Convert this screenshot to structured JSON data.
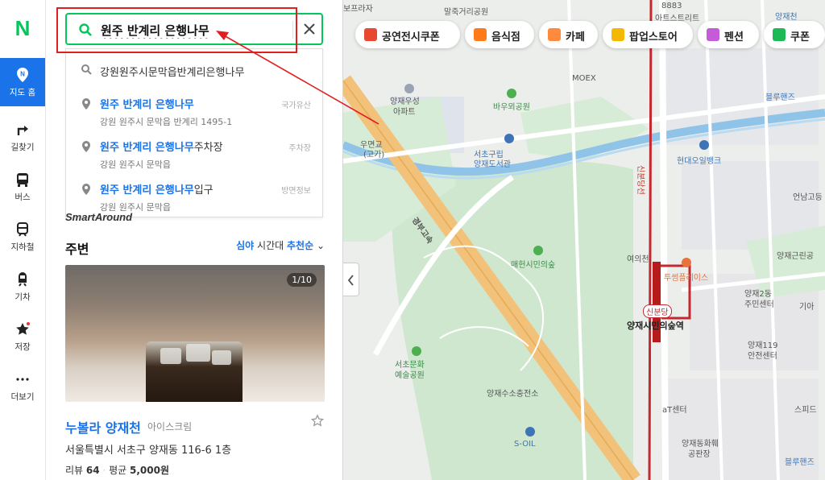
{
  "rail": {
    "logo": "N",
    "items": [
      {
        "label": "지도 홈",
        "icon": "map-pin-icon"
      },
      {
        "label": "길찾기",
        "icon": "directions-icon"
      },
      {
        "label": "버스",
        "icon": "bus-icon"
      },
      {
        "label": "지하철",
        "icon": "subway-icon"
      },
      {
        "label": "기차",
        "icon": "train-icon"
      },
      {
        "label": "저장",
        "icon": "star-icon"
      },
      {
        "label": "더보기",
        "icon": "more-icon"
      }
    ]
  },
  "search": {
    "value": "원주 반계리 은행나무",
    "suggestions": [
      {
        "title": "강원원주시문막읍반계리은행나무",
        "highlight": "",
        "rest": "",
        "sub": "",
        "category": ""
      },
      {
        "highlight": "원주 반계리 은행나무",
        "rest": "",
        "sub": "강원 원주시 문막읍 반계리 1495-1",
        "category": "국가유산"
      },
      {
        "highlight": "원주 반계리 은행나무",
        "rest": "주차장",
        "sub": "강원 원주시 문막읍",
        "category": "주차장"
      },
      {
        "highlight": "원주 반계리 은행나무",
        "rest": "입구",
        "sub": "강원 원주시 문막읍",
        "category": "방면정보"
      }
    ]
  },
  "panel": {
    "smart_around": "SmartAround",
    "nearby_title": "주변",
    "time_highlight": "심야",
    "time_label": " 시간대 ",
    "sort_label": "추천순",
    "photo_counter": "1/10",
    "place": {
      "name": "누볼라 양재천",
      "category": "아이스크림",
      "address": "서울특별시 서초구 양재동 116-6 1층",
      "reviews_label": "리뷰",
      "reviews_count": "64",
      "avg_label": "평균",
      "avg_price": "5,000원"
    }
  },
  "map": {
    "chips": [
      {
        "label": "공연전시쿠폰",
        "color": "#e8482f"
      },
      {
        "label": "음식점",
        "color": "#ff7a1a"
      },
      {
        "label": "카페",
        "color": "#ff8a3d"
      },
      {
        "label": "팝업스토어",
        "color": "#f5b800"
      },
      {
        "label": "펜션",
        "color": "#c45bd8"
      },
      {
        "label": "쿠폰",
        "color": "#1db954"
      }
    ],
    "labels": [
      "보프라자",
      "말죽거리공원",
      "8883",
      "아트스트리트",
      "양재천",
      "MOEX",
      "양재우성",
      "아파트",
      "바우뫼공원",
      "블루핸즈",
      "우면교",
      "(고가)",
      "서초구립",
      "양재도서관",
      "현대오일뱅크",
      "신분당선",
      "언남고등",
      "경부고속",
      "매헌시민의숲",
      "여의천",
      "투썸플레이스",
      "양재2동",
      "주민센터",
      "기아",
      "양재근린공",
      "신분당",
      "양재시민의숲역",
      "서초문화",
      "예술공원",
      "양재119",
      "안전센터",
      "양재수소충전소",
      "aT센터",
      "스피드",
      "S-OIL",
      "양재동화훼",
      "공판장",
      "블루핸즈"
    ]
  }
}
